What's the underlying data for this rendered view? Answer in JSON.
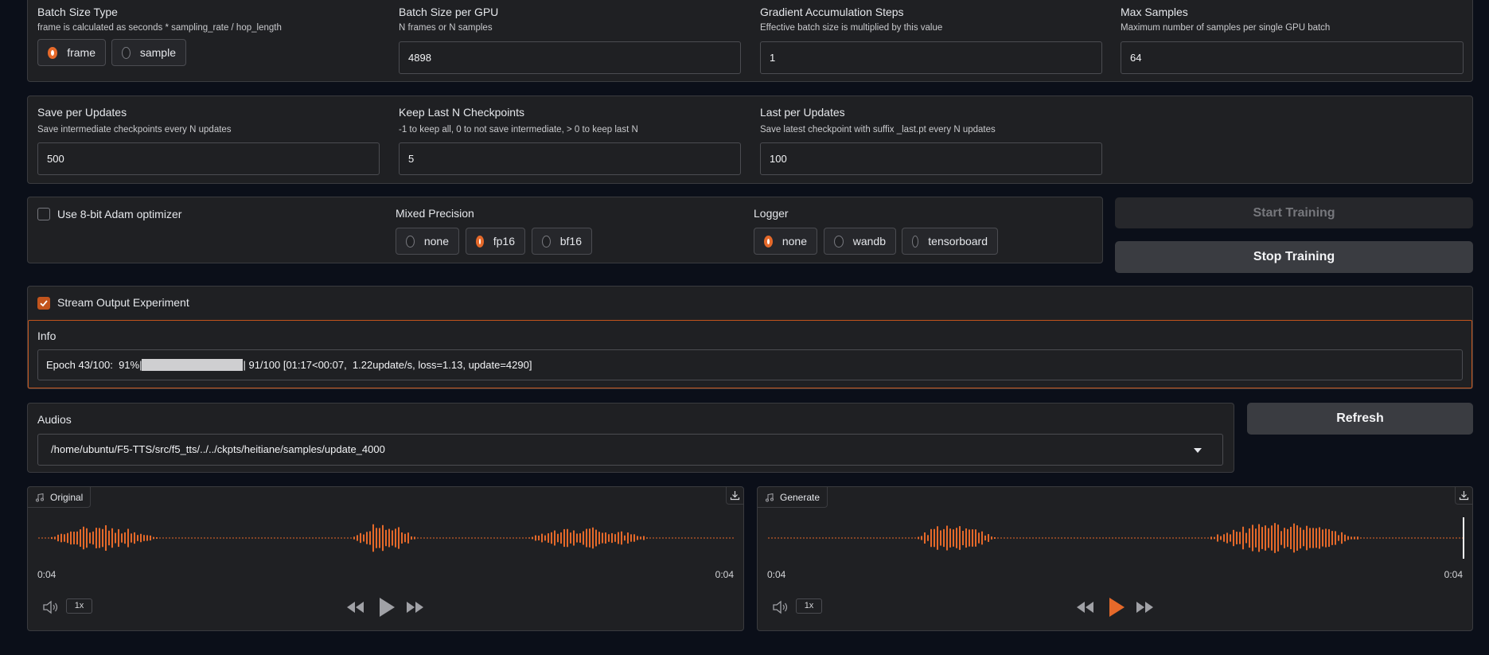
{
  "batch": {
    "size_type": {
      "label": "Batch Size Type",
      "info": "frame is calculated as seconds * sampling_rate / hop_length",
      "options": [
        "frame",
        "sample"
      ],
      "selected": "frame"
    },
    "per_gpu": {
      "label": "Batch Size per GPU",
      "info": "N frames or N samples",
      "value": "4898"
    },
    "grad_accum": {
      "label": "Gradient Accumulation Steps",
      "info": "Effective batch size is multiplied by this value",
      "value": "1"
    },
    "max_samples": {
      "label": "Max Samples",
      "info": "Maximum number of samples per single GPU batch",
      "value": "64"
    }
  },
  "checkpoints": {
    "save_per_updates": {
      "label": "Save per Updates",
      "info": "Save intermediate checkpoints every N updates",
      "value": "500"
    },
    "keep_last": {
      "label": "Keep Last N Checkpoints",
      "info": "-1 to keep all, 0 to not save intermediate, > 0 to keep last N",
      "value": "5"
    },
    "last_per_updates": {
      "label": "Last per Updates",
      "info": "Save latest checkpoint with suffix _last.pt every N updates",
      "value": "100"
    }
  },
  "options": {
    "adam8bit": {
      "label": "Use 8-bit Adam optimizer",
      "checked": false
    },
    "mixed_precision": {
      "label": "Mixed Precision",
      "options": [
        "none",
        "fp16",
        "bf16"
      ],
      "selected": "fp16"
    },
    "logger": {
      "label": "Logger",
      "options": [
        "none",
        "wandb",
        "tensorboard"
      ],
      "selected": "none"
    }
  },
  "buttons": {
    "start": "Start Training",
    "stop": "Stop Training",
    "refresh": "Refresh"
  },
  "stream": {
    "label": "Stream Output Experiment",
    "checked": true
  },
  "info": {
    "label": "Info",
    "prefix": "Epoch 43/100:  91%|",
    "suffix": "| 91/100 [01:17<00:07,  1.22update/s, loss=1.13, update=4290]",
    "progress": 0.91
  },
  "audios": {
    "label": "Audios",
    "selected": "/home/ubuntu/F5-TTS/src/f5_tts/../../ckpts/heitiane/samples/update_4000"
  },
  "players": [
    {
      "label": "Original",
      "time_start": "0:04",
      "time_end": "0:04",
      "speed": "1x"
    },
    {
      "label": "Generate",
      "time_start": "0:04",
      "time_end": "0:04",
      "speed": "1x"
    }
  ],
  "colors": {
    "accent": "#e5692a",
    "panel": "#1f2023",
    "background": "#0b0f19",
    "waveform": "#e5692a",
    "border_active": "#c2541d"
  }
}
